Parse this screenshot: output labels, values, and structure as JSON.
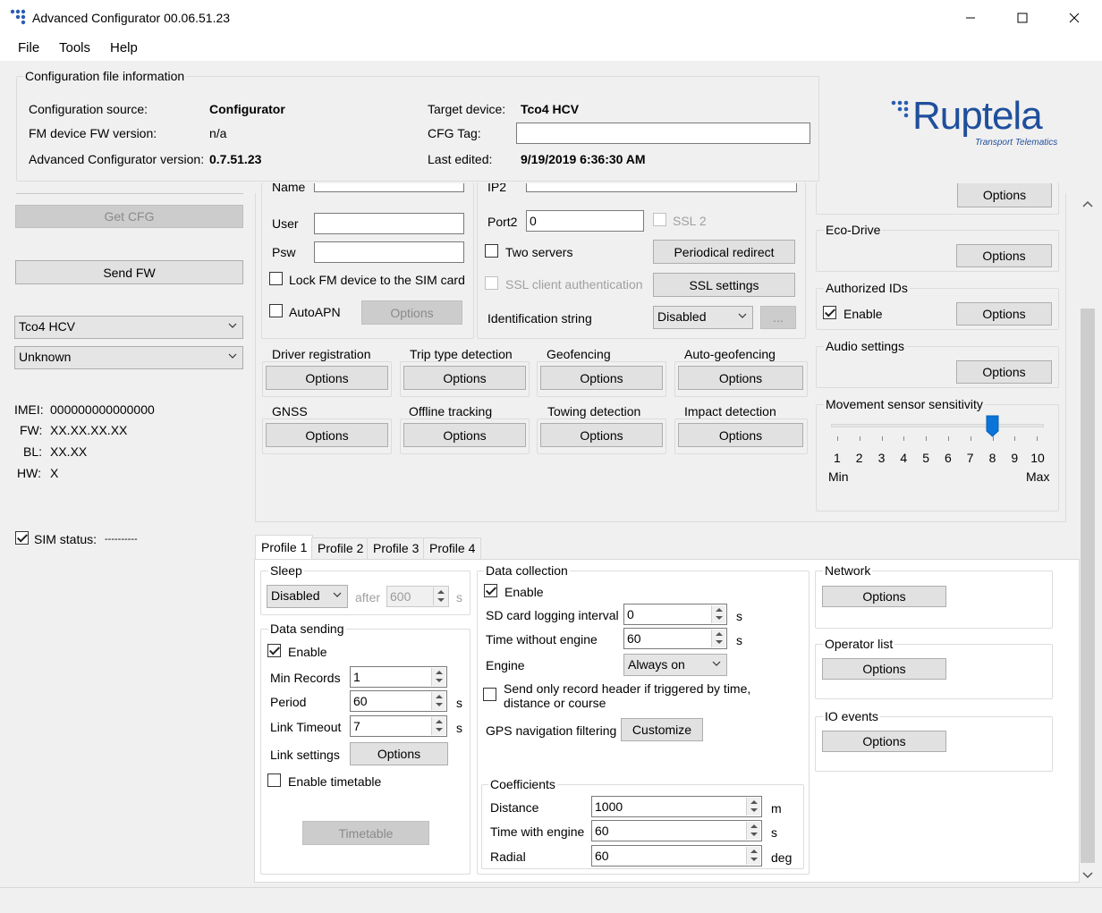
{
  "window": {
    "title": "Advanced Configurator 00.06.51.23",
    "minimize_label": "—",
    "maximize_label": "☐",
    "close_label": "✕"
  },
  "menu": {
    "file": "File",
    "tools": "Tools",
    "help": "Help"
  },
  "config_info": {
    "title": "Configuration file information",
    "source_label": "Configuration source:",
    "source_value": "Configurator",
    "fm_fw_label": "FM device FW version:",
    "fm_fw_value": "n/a",
    "adv_ver_label": "Advanced Configurator version:",
    "adv_ver_value": "0.7.51.23",
    "target_label": "Target device:",
    "target_value": "Tco4 HCV",
    "cfg_tag_label": "CFG Tag:",
    "cfg_tag_value": "",
    "last_edited_label": "Last edited:",
    "last_edited_value": "9/19/2019 6:36:30 AM"
  },
  "logo": {
    "brand": "Ruptela",
    "tagline": "Transport Telematics",
    "color": "#1f4f9c"
  },
  "left": {
    "get_cfg": "Get CFG",
    "send_fw": "Send FW",
    "device_select": "Tco4 HCV",
    "status_select": "Unknown",
    "imei_label": "IMEI:",
    "imei_value": "000000000000000",
    "fw_label": "FW:",
    "fw_value": "XX.XX.XX.XX",
    "bl_label": "BL:",
    "bl_value": "XX.XX",
    "hw_label": "HW:",
    "hw_value": "X",
    "sim_label": "SIM status:",
    "sim_value": "----------"
  },
  "gprs": {
    "name_label": "Name",
    "user_label": "User",
    "psw_label": "Psw",
    "lock_label": "Lock FM device to the SIM card",
    "autoapn_label": "AutoAPN",
    "options_label": "Options",
    "ip2_label": "IP2",
    "port2_label": "Port2",
    "port2_value": "0",
    "ssl2_label": "SSL 2",
    "two_servers_label": "Two servers",
    "periodical_redirect": "Periodical redirect",
    "ssl_client_auth": "SSL client authentication",
    "ssl_settings": "SSL settings",
    "ident_label": "Identification string",
    "ident_value": "Disabled",
    "ellipsis": "..."
  },
  "features": [
    {
      "title": "Driver registration",
      "button": "Options"
    },
    {
      "title": "Trip type detection",
      "button": "Options"
    },
    {
      "title": "Geofencing",
      "button": "Options"
    },
    {
      "title": "Auto-geofencing",
      "button": "Options"
    },
    {
      "title": "GNSS",
      "button": "Options"
    },
    {
      "title": "Offline tracking",
      "button": "Options"
    },
    {
      "title": "Towing detection",
      "button": "Options"
    },
    {
      "title": "Impact detection",
      "button": "Options"
    }
  ],
  "right": {
    "top_options": "Options",
    "eco_title": "Eco-Drive",
    "eco_options": "Options",
    "auth_title": "Authorized IDs",
    "auth_enable": "Enable",
    "auth_options": "Options",
    "audio_title": "Audio settings",
    "audio_options": "Options",
    "movement_title": "Movement sensor sensitivity",
    "ticks": [
      "1",
      "2",
      "3",
      "4",
      "5",
      "6",
      "7",
      "8",
      "9",
      "10"
    ],
    "min_label": "Min",
    "max_label": "Max",
    "slider_value": 8
  },
  "tabs": [
    "Profile 1",
    "Profile 2",
    "Profile 3",
    "Profile 4"
  ],
  "profile": {
    "sleep_title": "Sleep",
    "sleep_mode": "Disabled",
    "after_label": "after",
    "after_value": "600",
    "s": "s",
    "data_sending_title": "Data sending",
    "ds_enable": "Enable",
    "min_records_label": "Min Records",
    "min_records_value": "1",
    "period_label": "Period",
    "period_value": "60",
    "link_timeout_label": "Link Timeout",
    "link_timeout_value": "7",
    "link_settings_label": "Link settings",
    "link_settings_button": "Options",
    "enable_timetable": "Enable timetable",
    "timetable_button": "Timetable",
    "data_collection_title": "Data collection",
    "dc_enable": "Enable",
    "sd_label": "SD card logging interval",
    "sd_value": "0",
    "twe_label": "Time without engine",
    "twe_value": "60",
    "engine_label": "Engine",
    "engine_value": "Always on",
    "send_header_line1": "Send only record header if triggered by time,",
    "send_header_line2": "distance or course",
    "gps_filter_label": "GPS navigation filtering",
    "customize_button": "Customize",
    "coefficients_title": "Coefficients",
    "distance_label": "Distance",
    "distance_value": "1000",
    "distance_unit": "m",
    "time_engine_label": "Time with engine",
    "time_engine_value": "60",
    "time_engine_unit": "s",
    "radial_label": "Radial",
    "radial_value": "60",
    "radial_unit": "deg",
    "network_title": "Network",
    "network_options": "Options",
    "operator_title": "Operator list",
    "operator_options": "Options",
    "io_title": "IO events",
    "io_options": "Options"
  }
}
